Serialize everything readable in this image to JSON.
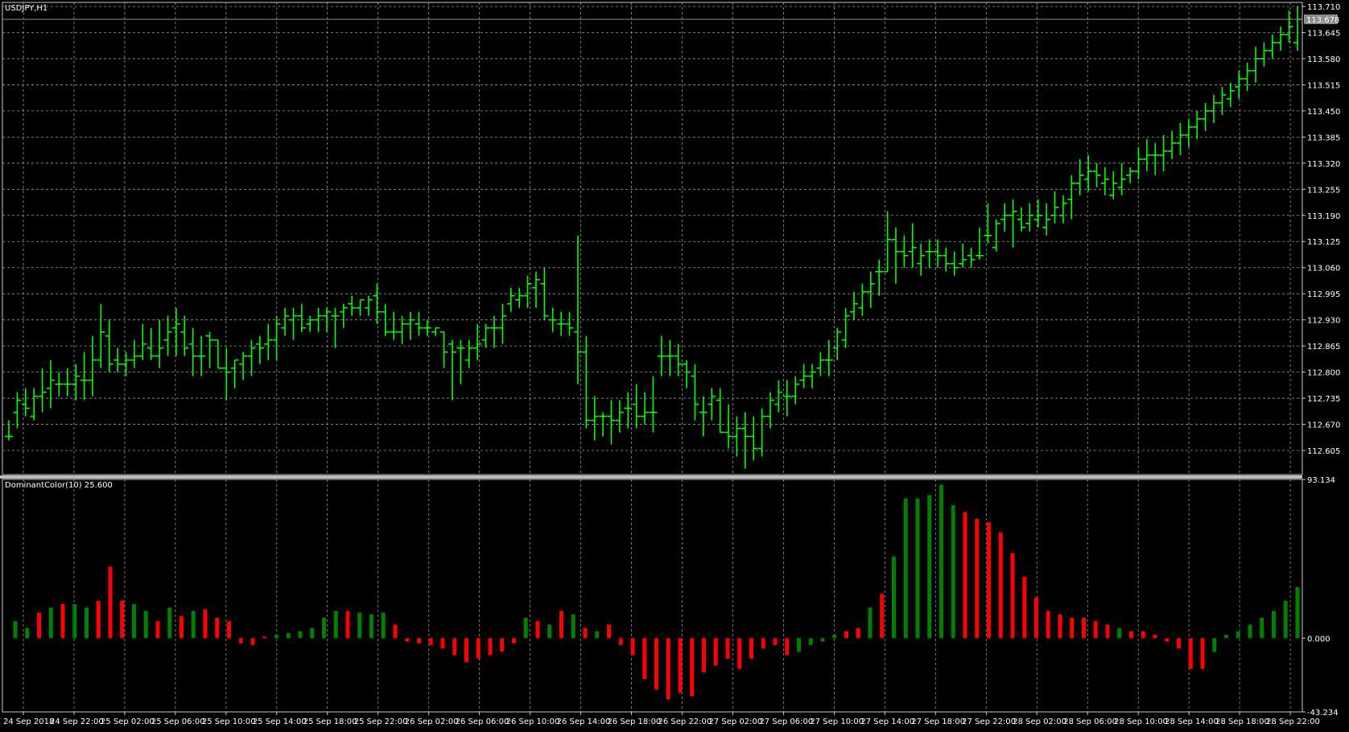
{
  "chart_data": {
    "type": "ohlc",
    "symbol_title": "USDJPY,H1",
    "current_price_label": "113.678",
    "bar_color": "#00ff00",
    "background": "#000000",
    "grid": true,
    "grid_color": "#9a9a9a",
    "price_axis": {
      "ylim": [
        112.545,
        113.72
      ],
      "ticks": [
        "113.710",
        "113.645",
        "113.580",
        "113.515",
        "113.450",
        "113.385",
        "113.320",
        "113.255",
        "113.190",
        "113.125",
        "113.060",
        "112.995",
        "112.930",
        "112.865",
        "112.800",
        "112.735",
        "112.670",
        "112.605"
      ]
    },
    "time_axis_labels": [
      "24 Sep 2018",
      "24 Sep 22:00",
      "25 Sep 02:00",
      "25 Sep 06:00",
      "25 Sep 10:00",
      "25 Sep 14:00",
      "25 Sep 18:00",
      "25 Sep 22:00",
      "26 Sep 02:00",
      "26 Sep 06:00",
      "26 Sep 10:00",
      "26 Sep 14:00",
      "26 Sep 18:00",
      "26 Sep 22:00",
      "27 Sep 02:00",
      "27 Sep 06:00",
      "27 Sep 10:00",
      "27 Sep 14:00",
      "27 Sep 18:00",
      "27 Sep 22:00",
      "28 Sep 02:00",
      "28 Sep 06:00",
      "28 Sep 10:00",
      "28 Sep 14:00",
      "28 Sep 18:00",
      "28 Sep 22:00"
    ],
    "bars": [
      [
        112.64,
        112.68,
        112.63,
        112.64
      ],
      [
        112.7,
        112.75,
        112.66,
        112.73
      ],
      [
        112.72,
        112.76,
        112.69,
        112.71
      ],
      [
        112.69,
        112.76,
        112.68,
        112.74
      ],
      [
        112.74,
        112.81,
        112.7,
        112.75
      ],
      [
        112.76,
        112.83,
        112.71,
        112.78
      ],
      [
        112.77,
        112.8,
        112.74,
        112.77
      ],
      [
        112.77,
        112.81,
        112.74,
        112.77
      ],
      [
        112.77,
        112.82,
        112.73,
        112.79
      ],
      [
        112.78,
        112.85,
        112.73,
        112.78
      ],
      [
        112.78,
        112.89,
        112.74,
        112.83
      ],
      [
        112.83,
        112.97,
        112.81,
        112.9
      ],
      [
        112.89,
        112.93,
        112.8,
        112.82
      ],
      [
        112.83,
        112.86,
        112.8,
        112.82
      ],
      [
        112.82,
        112.85,
        112.79,
        112.83
      ],
      [
        112.83,
        112.88,
        112.81,
        112.84
      ],
      [
        112.84,
        112.92,
        112.83,
        112.87
      ],
      [
        112.86,
        112.91,
        112.83,
        112.84
      ],
      [
        112.84,
        112.93,
        112.81,
        112.86
      ],
      [
        112.88,
        112.94,
        112.84,
        112.9
      ],
      [
        112.91,
        112.96,
        112.84,
        112.92
      ],
      [
        112.9,
        112.94,
        112.84,
        112.86
      ],
      [
        112.87,
        112.91,
        112.79,
        112.84
      ],
      [
        112.84,
        112.89,
        112.79,
        112.84
      ],
      [
        112.89,
        112.9,
        112.81,
        112.88
      ],
      [
        112.88,
        112.88,
        112.81,
        112.81
      ],
      [
        112.81,
        112.86,
        112.73,
        112.8
      ],
      [
        112.81,
        112.83,
        112.76,
        112.83
      ],
      [
        112.82,
        112.85,
        112.78,
        112.84
      ],
      [
        112.84,
        112.88,
        112.79,
        112.86
      ],
      [
        112.87,
        112.89,
        112.82,
        112.86
      ],
      [
        112.87,
        112.92,
        112.83,
        112.88
      ],
      [
        112.88,
        112.94,
        112.83,
        112.92
      ],
      [
        112.91,
        112.96,
        112.89,
        112.94
      ],
      [
        112.93,
        112.96,
        112.88,
        112.94
      ],
      [
        112.94,
        112.97,
        112.9,
        112.91
      ],
      [
        112.92,
        112.94,
        112.9,
        112.93
      ],
      [
        112.93,
        112.96,
        112.9,
        112.94
      ],
      [
        112.94,
        112.96,
        112.9,
        112.95
      ],
      [
        112.94,
        112.96,
        112.86,
        112.94
      ],
      [
        112.95,
        112.97,
        112.91,
        112.96
      ],
      [
        112.97,
        112.99,
        112.94,
        112.96
      ],
      [
        112.96,
        112.98,
        112.94,
        112.98
      ],
      [
        112.96,
        112.99,
        112.94,
        112.98
      ],
      [
        112.99,
        113.02,
        112.92,
        112.95
      ],
      [
        112.95,
        112.97,
        112.89,
        112.9
      ],
      [
        112.9,
        112.95,
        112.88,
        112.9
      ],
      [
        112.9,
        112.94,
        112.87,
        112.92
      ],
      [
        112.92,
        112.95,
        112.88,
        112.93
      ],
      [
        112.92,
        112.95,
        112.89,
        112.91
      ],
      [
        112.91,
        112.93,
        112.89,
        112.91
      ],
      [
        112.9,
        112.91,
        112.89,
        112.91
      ],
      [
        112.9,
        112.9,
        112.81,
        112.85
      ],
      [
        112.87,
        112.88,
        112.73,
        112.85
      ],
      [
        112.86,
        112.88,
        112.77,
        112.86
      ],
      [
        112.83,
        112.88,
        112.81,
        112.86
      ],
      [
        112.86,
        112.92,
        112.83,
        112.87
      ],
      [
        112.88,
        112.92,
        112.86,
        112.91
      ],
      [
        112.91,
        112.94,
        112.86,
        112.91
      ],
      [
        112.91,
        112.97,
        112.87,
        112.94
      ],
      [
        112.97,
        113.01,
        112.95,
        112.99
      ],
      [
        112.98,
        113.01,
        112.96,
        112.99
      ],
      [
        112.99,
        113.04,
        112.96,
        113.02
      ],
      [
        113.01,
        113.05,
        112.96,
        113.03
      ],
      [
        113.02,
        113.06,
        112.93,
        112.94
      ],
      [
        112.93,
        112.96,
        112.9,
        112.93
      ],
      [
        112.92,
        112.95,
        112.89,
        112.92
      ],
      [
        112.92,
        112.95,
        112.89,
        112.91
      ],
      [
        112.9,
        113.14,
        112.77,
        112.85
      ],
      [
        112.85,
        112.89,
        112.66,
        112.68
      ],
      [
        112.68,
        112.74,
        112.63,
        112.69
      ],
      [
        112.69,
        112.7,
        112.64,
        112.69
      ],
      [
        112.69,
        112.73,
        112.62,
        112.68
      ],
      [
        112.68,
        112.73,
        112.65,
        112.7
      ],
      [
        112.71,
        112.75,
        112.66,
        112.71
      ],
      [
        112.72,
        112.77,
        112.66,
        112.69
      ],
      [
        112.69,
        112.75,
        112.67,
        112.7
      ],
      [
        112.7,
        112.79,
        112.65,
        112.7
      ],
      [
        112.84,
        112.89,
        112.79,
        112.84
      ],
      [
        112.84,
        112.88,
        112.79,
        112.84
      ],
      [
        112.84,
        112.87,
        112.79,
        112.82
      ],
      [
        112.82,
        112.83,
        112.76,
        112.8
      ],
      [
        112.79,
        112.82,
        112.68,
        112.72
      ],
      [
        112.7,
        112.74,
        112.64,
        112.7
      ],
      [
        112.72,
        112.76,
        112.68,
        112.74
      ],
      [
        112.73,
        112.76,
        112.65,
        112.65
      ],
      [
        112.65,
        112.72,
        112.61,
        112.64
      ],
      [
        112.64,
        112.69,
        112.59,
        112.66
      ],
      [
        112.66,
        112.7,
        112.56,
        112.64
      ],
      [
        112.64,
        112.69,
        112.58,
        112.61
      ],
      [
        112.61,
        112.71,
        112.59,
        112.69
      ],
      [
        112.69,
        112.75,
        112.66,
        112.73
      ],
      [
        112.72,
        112.78,
        112.7,
        112.75
      ],
      [
        112.74,
        112.78,
        112.69,
        112.74
      ],
      [
        112.74,
        112.79,
        112.72,
        112.77
      ],
      [
        112.78,
        112.82,
        112.76,
        112.79
      ],
      [
        112.79,
        112.82,
        112.76,
        112.8
      ],
      [
        112.81,
        112.85,
        112.79,
        112.83
      ],
      [
        112.83,
        112.88,
        112.79,
        112.83
      ],
      [
        112.86,
        112.91,
        112.83,
        112.9
      ],
      [
        112.88,
        112.96,
        112.86,
        112.94
      ],
      [
        112.95,
        113.0,
        112.93,
        112.97
      ],
      [
        112.96,
        113.02,
        112.94,
        113.0
      ],
      [
        113.0,
        113.05,
        112.96,
        113.02
      ],
      [
        113.05,
        113.08,
        112.99,
        113.05
      ],
      [
        113.05,
        113.2,
        113.05,
        113.13
      ],
      [
        113.13,
        113.16,
        113.02,
        113.1
      ],
      [
        113.1,
        113.14,
        113.06,
        113.09
      ],
      [
        113.1,
        113.17,
        113.06,
        113.11
      ],
      [
        113.07,
        113.12,
        113.04,
        113.09
      ],
      [
        113.1,
        113.13,
        113.06,
        113.1
      ],
      [
        113.1,
        113.13,
        113.06,
        113.09
      ],
      [
        113.09,
        113.11,
        113.05,
        113.07
      ],
      [
        113.07,
        113.1,
        113.04,
        113.06
      ],
      [
        113.07,
        113.12,
        113.06,
        113.08
      ],
      [
        113.09,
        113.11,
        113.06,
        113.08
      ],
      [
        113.09,
        113.16,
        113.08,
        113.09
      ],
      [
        113.14,
        113.22,
        113.12,
        113.14
      ],
      [
        113.11,
        113.18,
        113.1,
        113.17
      ],
      [
        113.18,
        113.22,
        113.15,
        113.19
      ],
      [
        113.19,
        113.23,
        113.11,
        113.2
      ],
      [
        113.18,
        113.21,
        113.15,
        113.16
      ],
      [
        113.17,
        113.22,
        113.15,
        113.19
      ],
      [
        113.18,
        113.23,
        113.16,
        113.19
      ],
      [
        113.16,
        113.22,
        113.14,
        113.18
      ],
      [
        113.19,
        113.25,
        113.17,
        113.21
      ],
      [
        113.19,
        113.24,
        113.17,
        113.22
      ],
      [
        113.23,
        113.29,
        113.18,
        113.27
      ],
      [
        113.27,
        113.33,
        113.24,
        113.29
      ],
      [
        113.28,
        113.34,
        113.25,
        113.3
      ],
      [
        113.3,
        113.32,
        113.26,
        113.29
      ],
      [
        113.27,
        113.31,
        113.24,
        113.28
      ],
      [
        113.24,
        113.3,
        113.23,
        113.27
      ],
      [
        113.26,
        113.32,
        113.24,
        113.28
      ],
      [
        113.29,
        113.31,
        113.27,
        113.3
      ],
      [
        113.3,
        113.36,
        113.28,
        113.33
      ],
      [
        113.33,
        113.38,
        113.3,
        113.34
      ],
      [
        113.34,
        113.37,
        113.29,
        113.34
      ],
      [
        113.34,
        113.39,
        113.3,
        113.35
      ],
      [
        113.35,
        113.4,
        113.33,
        113.37
      ],
      [
        113.37,
        113.42,
        113.34,
        113.39
      ],
      [
        113.39,
        113.43,
        113.36,
        113.41
      ],
      [
        113.41,
        113.45,
        113.38,
        113.43
      ],
      [
        113.43,
        113.47,
        113.4,
        113.45
      ],
      [
        113.45,
        113.49,
        113.42,
        113.47
      ],
      [
        113.47,
        113.51,
        113.44,
        113.49
      ],
      [
        113.48,
        113.52,
        113.46,
        113.5
      ],
      [
        113.51,
        113.55,
        113.48,
        113.53
      ],
      [
        113.53,
        113.57,
        113.5,
        113.55
      ],
      [
        113.55,
        113.61,
        113.52,
        113.58
      ],
      [
        113.58,
        113.62,
        113.56,
        113.6
      ],
      [
        113.6,
        113.64,
        113.58,
        113.62
      ],
      [
        113.62,
        113.66,
        113.6,
        113.64
      ],
      [
        113.64,
        113.7,
        113.62,
        113.66
      ],
      [
        113.62,
        113.71,
        113.6,
        113.678
      ]
    ],
    "indicator": {
      "title": "DominantColor(10) 25.600",
      "ylim": [
        -43.234,
        93.134
      ],
      "ticks": [
        "93.134",
        "0.000",
        "-43.234"
      ],
      "up_color": "#008000",
      "down_color": "#ff0000",
      "values": [
        10,
        6,
        15,
        18,
        20,
        20,
        18,
        22,
        42,
        22,
        20,
        16,
        10,
        18,
        13,
        16,
        17,
        12,
        10,
        -3,
        -4,
        1,
        2,
        3,
        4,
        6,
        12,
        16,
        16,
        15,
        14,
        15,
        8,
        -2,
        -3,
        -4,
        -6,
        -10,
        -14,
        -12,
        -10,
        -8,
        -3,
        12,
        10,
        8,
        16,
        14,
        6,
        4,
        8,
        -4,
        -10,
        -24,
        -30,
        -36,
        -32,
        -34,
        -20,
        -16,
        -12,
        -18,
        -12,
        -6,
        -4,
        -10,
        -8,
        -4,
        -2,
        2,
        4,
        6,
        18,
        26,
        48,
        82,
        82,
        84,
        90,
        78,
        74,
        70,
        68,
        62,
        50,
        36,
        24,
        16,
        14,
        12,
        12,
        10,
        8,
        6,
        4,
        4,
        2,
        -2,
        -6,
        -18,
        -18,
        -8,
        2,
        4,
        8,
        12,
        16,
        22,
        30
      ],
      "signs": "ggrgrggrrrggrgrgrrrr rrggggggrgggrrrrrrrr rrrgrgrgrgrrrrrrrrrrr rrrrrggggrrgrggggggrrr rrrrrrrrrrgrrrrrrrgg gggggggrgg"
    }
  }
}
